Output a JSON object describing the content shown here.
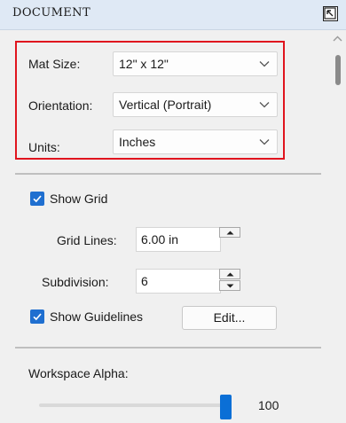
{
  "panel": {
    "title": "DOCUMENT"
  },
  "mat": {
    "size_label": "Mat Size:",
    "size_value": "12\" x 12\"",
    "orientation_label": "Orientation:",
    "orientation_value": "Vertical (Portrait)",
    "units_label": "Units:",
    "units_value": "Inches"
  },
  "grid": {
    "show_grid_label": "Show Grid",
    "show_grid_checked": true,
    "grid_lines_label": "Grid Lines:",
    "grid_lines_value": "6.00 in",
    "subdivision_label": "Subdivision:",
    "subdivision_value": "6",
    "show_guidelines_label": "Show Guidelines",
    "show_guidelines_checked": true,
    "edit_button_label": "Edit..."
  },
  "workspace": {
    "alpha_label": "Workspace Alpha:",
    "alpha_value": "100",
    "alpha_fraction": 1.0
  },
  "colors": {
    "highlight": "#e0141e",
    "accent": "#1f6fd0",
    "title_bg": "#dfe9f5"
  }
}
